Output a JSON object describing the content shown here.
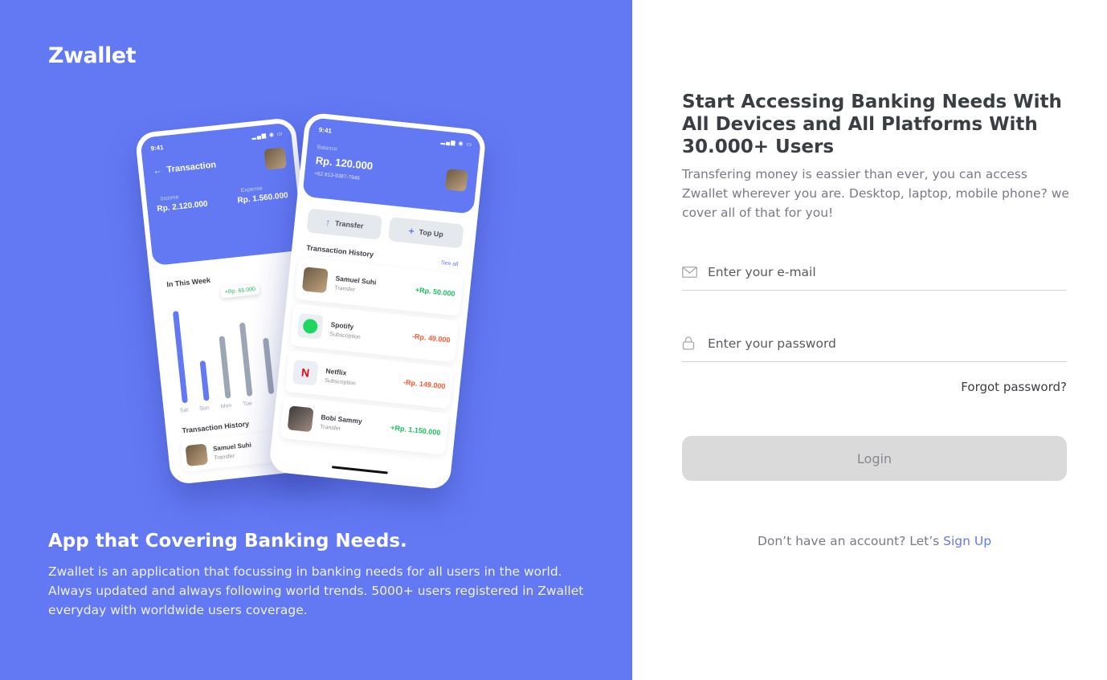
{
  "brand": "Zwallet",
  "left": {
    "title": "App that Covering Banking Needs.",
    "description": "Zwallet is an application that focussing in banking needs for all users in the world. Always updated and always following world trends. 5000+ users registered in Zwallet everyday with worldwide users coverage."
  },
  "phone_back": {
    "time": "9:41",
    "title": "Transaction",
    "income_label": "Income",
    "income_value": "Rp. 2.120.000",
    "expense_label": "Expense",
    "expense_value": "Rp. 1.560.000",
    "week_label": "In This Week",
    "tooltip": "+Rp. 65.000",
    "days": [
      "Sat",
      "Sun",
      "Mon",
      "Tue"
    ],
    "history_label": "Transaction History",
    "item_name": "Samuel Suhi",
    "item_sub": "Transfer"
  },
  "phone_front": {
    "time": "9:41",
    "balance_label": "Balance",
    "balance_value": "Rp. 120.000",
    "phone_number": "+62 813-9387-7946",
    "transfer_label": "Transfer",
    "topup_label": "Top Up",
    "history_label": "Transaction History",
    "see_all": "See all",
    "transactions": [
      {
        "name": "Samuel Suhi",
        "type": "Transfer",
        "amount": "+Rp. 50.000"
      },
      {
        "name": "Spotify",
        "type": "Subscription",
        "amount": "-Rp. 49.000"
      },
      {
        "name": "Netflix",
        "type": "Subscription",
        "amount": "-Rp. 149.000"
      },
      {
        "name": "Bobi Sammy",
        "type": "Transfer",
        "amount": "+Rp. 1.150.000"
      }
    ]
  },
  "right": {
    "title": "Start Accessing Banking Needs With All Devices and All Platforms With 30.000+ Users",
    "description": "Transfering money is eassier than ever, you can access Zwallet wherever you are. Desktop, laptop, mobile phone? we cover all of that for you!"
  },
  "form": {
    "email_placeholder": "Enter your e-mail",
    "password_placeholder": "Enter your password",
    "forgot_label": "Forgot password?",
    "login_label": "Login",
    "signup_prompt": "Don’t have an account? Let’s ",
    "signup_link": "Sign Up"
  },
  "colors": {
    "primary": "#6379F4",
    "positive": "#1EC15F",
    "negative": "#FF5B37",
    "button_disabled": "#DADADA"
  },
  "icons": {
    "email": "mail-icon",
    "password": "lock-icon",
    "back": "arrow-left-icon",
    "transfer": "arrow-up-icon",
    "topup": "plus-icon"
  }
}
